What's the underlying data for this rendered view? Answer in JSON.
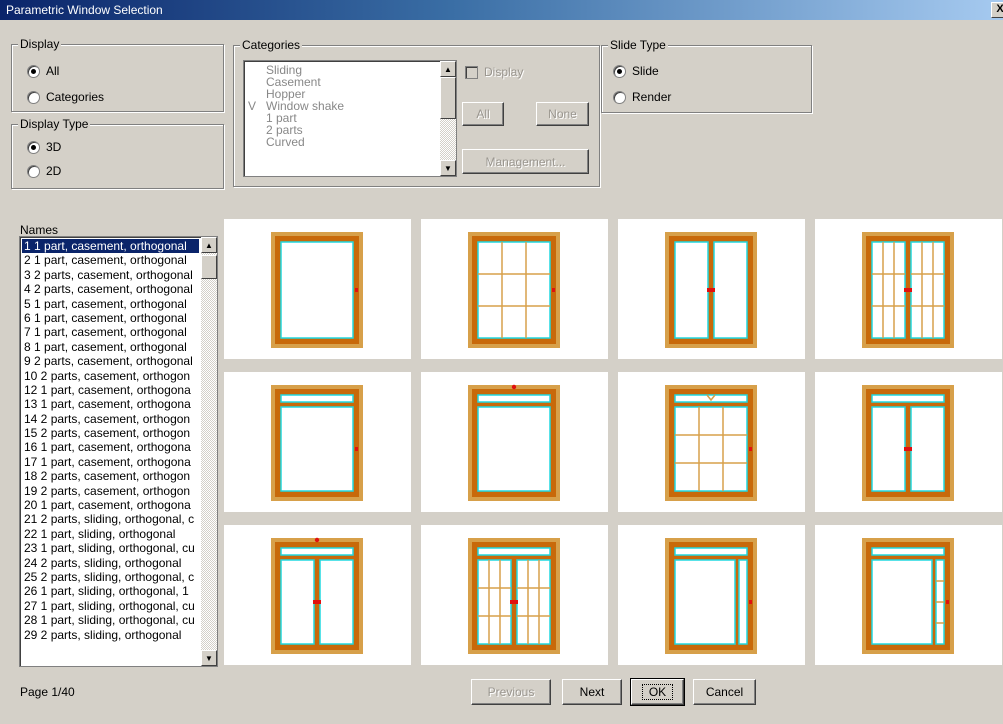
{
  "window": {
    "title": "Parametric Window Selection",
    "close_label": "X"
  },
  "display": {
    "legend": "Display",
    "options": [
      "All",
      "Categories"
    ],
    "selected": "All"
  },
  "display_type": {
    "legend": "Display Type",
    "options": [
      "3D",
      "2D"
    ],
    "selected": "3D"
  },
  "categories": {
    "legend": "Categories",
    "items": [
      {
        "mark": "",
        "label": "Sliding"
      },
      {
        "mark": "",
        "label": "Casement"
      },
      {
        "mark": "",
        "label": "Hopper"
      },
      {
        "mark": "V",
        "label": "Window shake"
      },
      {
        "mark": "",
        "label": "1 part"
      },
      {
        "mark": "",
        "label": "2 parts"
      },
      {
        "mark": "",
        "label": "Curved"
      }
    ],
    "display_checkbox_label": "Display",
    "all_label": "All",
    "none_label": "None",
    "management_label": "Management..."
  },
  "slide_type": {
    "legend": "Slide Type",
    "options": [
      "Slide",
      "Render"
    ],
    "selected": "Slide"
  },
  "names": {
    "label": "Names",
    "items": [
      "1 1 part, casement, orthogonal",
      "2 1 part, casement, orthogonal",
      "3 2 parts, casement, orthogonal",
      "4 2 parts, casement, orthogonal",
      "5 1 part, casement, orthogonal",
      "6 1 part, casement, orthogonal",
      "7 1 part, casement, orthogonal",
      "8 1 part, casement, orthogonal",
      "9 2 parts, casement, orthogonal",
      "10 2 parts, casement, orthogon",
      "12 1 part, casement, orthogona",
      "13 1 part, casement, orthogona",
      "14 2 parts, casement, orthogon",
      "15 2 parts, casement, orthogon",
      "16 1 part, casement, orthogona",
      "17 1 part, casement, orthogona",
      "18 2 parts, casement, orthogon",
      "19 2 parts, casement, orthogon",
      "20 1 part, casement, orthogona",
      "21 2 parts, sliding, orthogonal, c",
      "22 1 part, sliding, orthogonal",
      "23 1 part, sliding, orthogonal, cu",
      "24 2 parts, sliding, orthogonal",
      "25 2 parts, sliding, orthogonal, c",
      "26 1 part, sliding, orthogonal, 1",
      "27 1 part, sliding, orthogonal, cu",
      "28 1 part, sliding, orthogonal, cu",
      "29 2 parts, sliding, orthogonal"
    ],
    "selected_index": 0
  },
  "thumbnails": [
    {
      "id": 1,
      "transom": false,
      "transom_mark": "",
      "cols": 1,
      "rows": 1,
      "mark": "right",
      "side_strip": false
    },
    {
      "id": 2,
      "transom": false,
      "transom_mark": "",
      "cols": 3,
      "rows": 3,
      "mark": "right",
      "side_strip": false
    },
    {
      "id": 3,
      "transom": false,
      "transom_mark": "",
      "cols": 2,
      "rows": 1,
      "mark": "center",
      "side_strip": false
    },
    {
      "id": 4,
      "transom": false,
      "transom_mark": "",
      "cols": 6,
      "rows": 3,
      "mark": "center",
      "side_strip": false
    },
    {
      "id": 5,
      "transom": true,
      "transom_mark": "",
      "cols": 1,
      "rows": 1,
      "mark": "right",
      "side_strip": false
    },
    {
      "id": 6,
      "transom": true,
      "transom_mark": "dot",
      "cols": 1,
      "rows": 1,
      "mark": "none",
      "side_strip": false
    },
    {
      "id": 7,
      "transom": true,
      "transom_mark": "v",
      "cols": 3,
      "rows": 3,
      "mark": "right",
      "side_strip": false
    },
    {
      "id": 8,
      "transom": true,
      "transom_mark": "",
      "cols": 2,
      "rows": 1,
      "mark": "center",
      "side_strip": false
    },
    {
      "id": 9,
      "transom": true,
      "transom_mark": "dot",
      "cols": 2,
      "rows": 1,
      "mark": "center",
      "side_strip": false
    },
    {
      "id": 10,
      "transom": true,
      "transom_mark": "",
      "cols": 6,
      "rows": 3,
      "mark": "center",
      "side_strip": false
    },
    {
      "id": 11,
      "transom": true,
      "transom_mark": "",
      "cols": 1,
      "rows": 1,
      "mark": "right",
      "side_strip": true
    },
    {
      "id": 12,
      "transom": true,
      "transom_mark": "",
      "cols": 1,
      "rows": 1,
      "mark": "right",
      "side_strip": true
    }
  ],
  "colors": {
    "frame_outer": "#d7a04a",
    "frame_inner": "#c8690a",
    "glass": "#ffffff",
    "glazing_bead": "#20d8e0",
    "handle": "#e01010",
    "muntin": "#d7a04a"
  },
  "pagination": {
    "page_label": "Page 1/40",
    "previous_label": "Previous",
    "next_label": "Next",
    "ok_label": "OK",
    "cancel_label": "Cancel"
  }
}
